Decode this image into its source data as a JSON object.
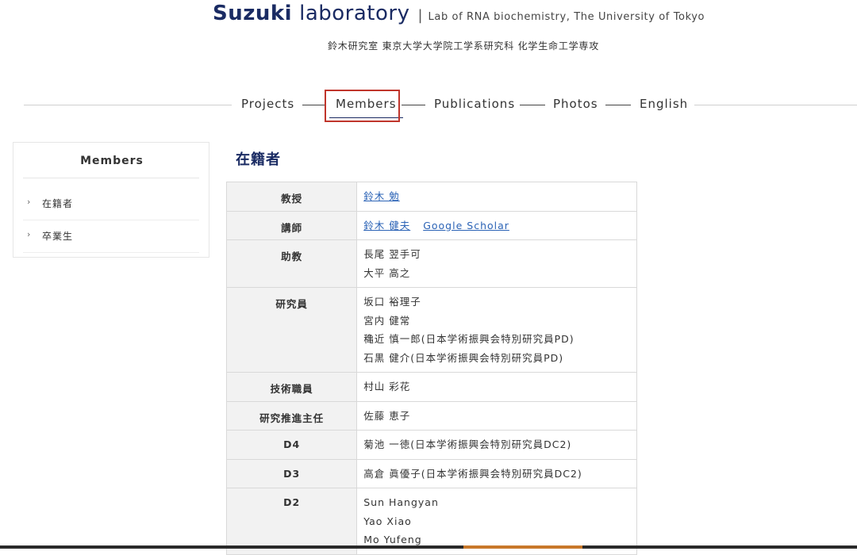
{
  "header": {
    "logo_name": "Suzuki",
    "logo_lab": "laboratory",
    "separator": "|",
    "subtitle_en": "Lab of RNA biochemistry, The University of Tokyo",
    "subtitle_jp": "鈴木研究室 東京大学大学院工学系研究科 化学生命工学専攻"
  },
  "nav": {
    "items": [
      {
        "label": "Projects"
      },
      {
        "label": "Members"
      },
      {
        "label": "Publications"
      },
      {
        "label": "Photos"
      },
      {
        "label": "English"
      }
    ],
    "active": "Members",
    "highlight_color": "#c0352b"
  },
  "sidebar": {
    "title": "Members",
    "items": [
      {
        "label": "在籍者",
        "icon": "chevron-right-icon"
      },
      {
        "label": "卒業生",
        "icon": "chevron-right-icon"
      }
    ]
  },
  "main": {
    "section_title": "在籍者",
    "rows": [
      {
        "role": "教授",
        "names": [],
        "links": [
          "鈴木 勉"
        ]
      },
      {
        "role": "講師",
        "names": [],
        "links": [
          "鈴木 健夫",
          "Google Scholar"
        ]
      },
      {
        "role": "助教",
        "names": [
          "長尾 翌手可",
          "大平 高之"
        ],
        "links": []
      },
      {
        "role": "研究員",
        "names": [
          "坂口 裕理子",
          "宮内 健常",
          "穐近 慎一郎(日本学術振興会特別研究員PD)",
          "石黒 健介(日本学術振興会特別研究員PD)"
        ],
        "links": []
      },
      {
        "role": "技術職員",
        "names": [
          "村山 彩花"
        ],
        "links": []
      },
      {
        "role": "研究推進主任",
        "names": [
          "佐藤 恵子"
        ],
        "links": []
      },
      {
        "role": "D4",
        "names": [
          "菊池 一徳(日本学術振興会特別研究員DC2)"
        ],
        "links": []
      },
      {
        "role": "D3",
        "names": [
          "高倉 眞優子(日本学術振興会特別研究員DC2)"
        ],
        "links": []
      },
      {
        "role": "D2",
        "names": [
          "Sun Hangyan",
          "Yao Xiao",
          "Mo Yufeng"
        ],
        "links": []
      }
    ]
  },
  "colors": {
    "brand": "#1a2b63",
    "link": "#2b63b6",
    "table_header_bg": "#f2f2f2"
  }
}
